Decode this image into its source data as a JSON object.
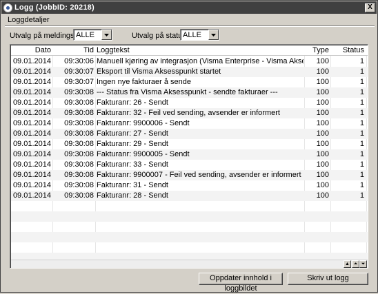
{
  "window": {
    "title": "Logg (JobbID: 20218)",
    "close_label": "X"
  },
  "group": {
    "label": "Loggdetaljer"
  },
  "filters": {
    "message_type_label": "Utvalg på meldingstype",
    "message_type_value": "ALLE",
    "status_label": "Utvalg på status",
    "status_value": "ALLE"
  },
  "table": {
    "columns": [
      "Dato",
      "Tid",
      "Loggtekst",
      "Type",
      "Status"
    ],
    "rows": [
      [
        "09.01.2014",
        "09:30:06",
        "Manuell kjøring av integrasjon (Visma Enterprise - Visma Aksesspunkt - utgående",
        "100",
        "1"
      ],
      [
        "09.01.2014",
        "09:30:07",
        "Eksport til Visma Aksesspunkt startet",
        "100",
        "1"
      ],
      [
        "09.01.2014",
        "09:30:07",
        "Ingen nye fakturaer å sende",
        "100",
        "1"
      ],
      [
        "09.01.2014",
        "09:30:08",
        "--- Status fra Visma Aksesspunkt - sendte fakturaer ---",
        "100",
        "1"
      ],
      [
        "09.01.2014",
        "09:30:08",
        "Fakturanr:  26 - Sendt",
        "100",
        "1"
      ],
      [
        "09.01.2014",
        "09:30:08",
        "Fakturanr:  32 - Feil ved sending, avsender er informert",
        "100",
        "1"
      ],
      [
        "09.01.2014",
        "09:30:08",
        "Fakturanr:  9900006 - Sendt",
        "100",
        "1"
      ],
      [
        "09.01.2014",
        "09:30:08",
        "Fakturanr:  27 - Sendt",
        "100",
        "1"
      ],
      [
        "09.01.2014",
        "09:30:08",
        "Fakturanr:  29 - Sendt",
        "100",
        "1"
      ],
      [
        "09.01.2014",
        "09:30:08",
        "Fakturanr:  9900005 - Sendt",
        "100",
        "1"
      ],
      [
        "09.01.2014",
        "09:30:08",
        "Fakturanr:  33 - Sendt",
        "100",
        "1"
      ],
      [
        "09.01.2014",
        "09:30:08",
        "Fakturanr:  9900007 - Feil ved sending, avsender er informert",
        "100",
        "1"
      ],
      [
        "09.01.2014",
        "09:30:08",
        "Fakturanr:  31 - Sendt",
        "100",
        "1"
      ],
      [
        "09.01.2014",
        "09:30:08",
        "Fakturanr:  28 - Sendt",
        "100",
        "1"
      ]
    ]
  },
  "buttons": {
    "refresh_label": "Oppdater innhold i loggbildet",
    "print_label": "Skriv ut logg"
  },
  "icons": {
    "app": "app-icon",
    "dropdown": "chevron-down-icon",
    "scroll_up": "double-chevron-up-icon",
    "scroll_down": "double-chevron-down-icon"
  }
}
